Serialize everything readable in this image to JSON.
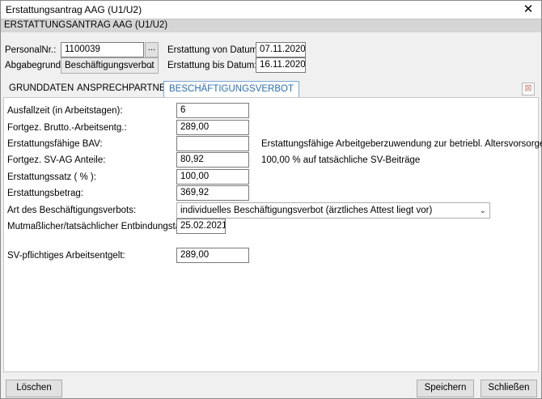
{
  "window": {
    "title": "Erstattungsantrag AAG (U1/U2)",
    "close_glyph": "✕"
  },
  "header": {
    "title": "ERSTATTUNGSANTRAG AAG (U1/U2)"
  },
  "form": {
    "personal_nr_label": "PersonalNr.:",
    "personal_nr_value": "1100039",
    "lookup_button": "...",
    "abgabegrund_label": "Abgabegrund:",
    "abgabegrund_value": "Beschäftigungsverbot",
    "von_label": "Erstattung von Datum:",
    "von_value": "07.11.2020",
    "bis_label": "Erstattung bis Datum:",
    "bis_value": "16.11.2020"
  },
  "tabs": [
    {
      "label": "GRUNDDATEN"
    },
    {
      "label": "ANSPRECHPARTNER"
    },
    {
      "label": "BESCHÄFTIGUNGSVERBOT"
    }
  ],
  "panel": {
    "ausfallzeit_label": "Ausfallzeit (in Arbeitstagen):",
    "ausfallzeit_value": "6",
    "brutto_label": "Fortgez. Brutto.-Arbeitsentg.:",
    "brutto_value": "289,00",
    "bav_label": "Erstattungsfähige BAV:",
    "bav_value": "",
    "bav_note": "Erstattungsfähige Arbeitgeberzuwendung zur betriebl. Altersvorsorge",
    "sv_ag_label": "Fortgez. SV-AG Anteile:",
    "sv_ag_value": "80,92",
    "sv_ag_note": "100,00 % auf tatsächliche SV-Beiträge",
    "satz_label": "Erstattungssatz ( % ):",
    "satz_value": "100,00",
    "betrag_label": "Erstattungsbetrag:",
    "betrag_value": "369,92",
    "art_label": "Art des Beschäftigungsverbots:",
    "art_value": "individuelles Beschäftigungsverbot (ärztliches Attest liegt vor)",
    "entbindung_label": "Mutmaßlicher/tatsächlicher Entbindungstag:",
    "entbindung_value": "25.02.2021",
    "sv_entgelt_label": "SV-pflichtiges Arbeitsentgelt:",
    "sv_entgelt_value": "289,00"
  },
  "footer": {
    "delete_label": "Löschen",
    "save_label": "Speichern",
    "close_label": "Schließen"
  },
  "colors": {
    "active_tab": "#2a6fb5",
    "header_band": "#d6d6d6"
  }
}
